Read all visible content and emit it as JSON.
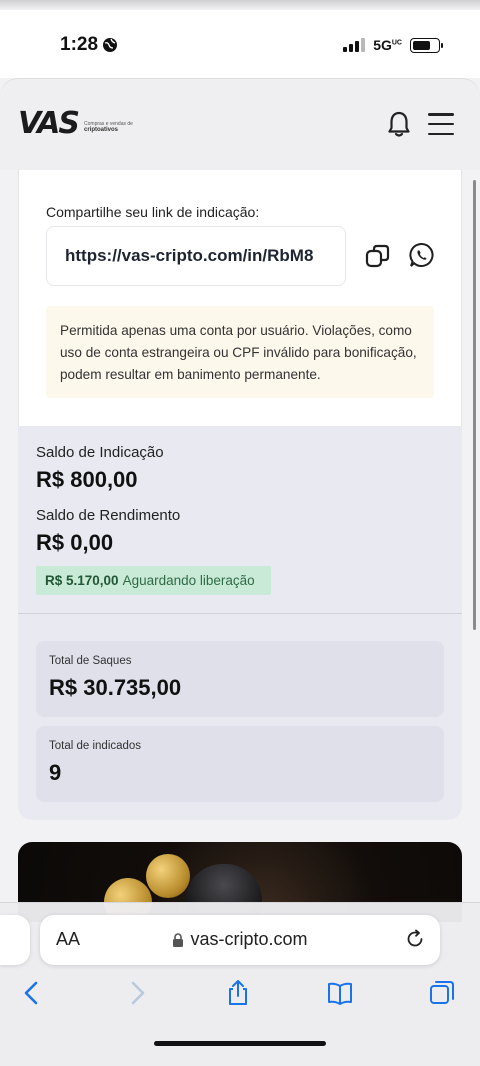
{
  "status_bar": {
    "time": "1:28",
    "network": "5G",
    "network_suffix": "UC"
  },
  "header": {
    "logo_text": "VAS",
    "logo_tagline": "Compras e vendas de",
    "logo_tagline_bold": "criptoativos"
  },
  "referral": {
    "share_label": "Compartilhe seu link de indicação:",
    "link": "https://vas-cripto.com/in/RbM8",
    "warning": "Permitida apenas uma conta por usuário. Violações, como uso de conta estrangeira ou CPF inválido para bonificação, podem resultar em banimento permanente."
  },
  "balances": {
    "referral_label": "Saldo de Indicação",
    "referral_value": "R$ 800,00",
    "yield_label": "Saldo de Rendimento",
    "yield_value": "R$ 0,00",
    "pending_amount": "R$ 5.170,00",
    "pending_text": "Aguardando liberação"
  },
  "totals": {
    "withdrawals_label": "Total de Saques",
    "withdrawals_value": "R$ 30.735,00",
    "referred_label": "Total de indicados",
    "referred_value": "9"
  },
  "browser": {
    "aa_label": "AA",
    "url": "vas-cripto.com"
  },
  "colors": {
    "pending_bg": "#c9ead6",
    "warning_bg": "#fdf8ec",
    "card_bg": "#e9eaf1",
    "whatsapp": "#1f1f1f"
  }
}
